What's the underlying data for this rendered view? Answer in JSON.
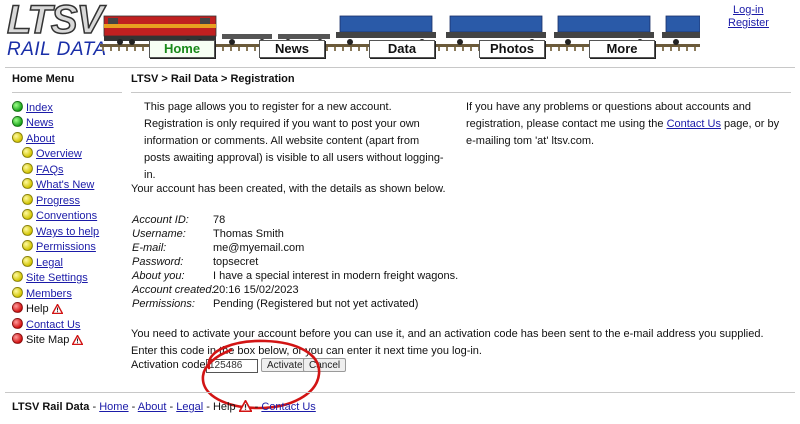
{
  "header": {
    "logo_top": "LTSV",
    "logo_bottom": "RAIL DATA",
    "nav": [
      "Home",
      "News",
      "Data",
      "Photos",
      "More"
    ],
    "active_nav": "Home",
    "auth": {
      "login": "Log-in",
      "register": "Register"
    }
  },
  "sidebar": {
    "heading": "Home Menu",
    "items": [
      {
        "label": "Index",
        "dot": "green"
      },
      {
        "label": "News",
        "dot": "green"
      },
      {
        "label": "About",
        "dot": "yellow"
      },
      {
        "label": "Overview",
        "dot": "yellow"
      },
      {
        "label": "FAQs",
        "dot": "yellow"
      },
      {
        "label": "What's New",
        "dot": "yellow"
      },
      {
        "label": "Progress",
        "dot": "yellow"
      },
      {
        "label": "Conventions",
        "dot": "yellow"
      },
      {
        "label": "Ways to help",
        "dot": "yellow"
      },
      {
        "label": "Permissions",
        "dot": "yellow"
      },
      {
        "label": "Legal",
        "dot": "yellow"
      },
      {
        "label": "Site Settings",
        "dot": "yellow"
      },
      {
        "label": "Members",
        "dot": "yellow"
      },
      {
        "label": "Help",
        "dot": "red"
      },
      {
        "label": "Contact Us",
        "dot": "red"
      },
      {
        "label": "Site Map",
        "dot": "red"
      }
    ]
  },
  "main": {
    "breadcrumb": "LTSV > Rail Data > Registration",
    "intro_left": "This page allows you to register for a new account. Registration is only required if you want to post your own information or comments. All website content (apart from posts awaiting approval) is visible to all users without logging-in.",
    "intro_right_before": "If you have any problems or questions about accounts and registration, please contact me using the ",
    "intro_right_link": "Contact Us",
    "intro_right_after": " page, or by e-mailing tom 'at' ltsv.com.",
    "created_msg": "Your account has been created, with the details as shown below.",
    "details": [
      {
        "label": "Account ID:",
        "value": "78"
      },
      {
        "label": "Username:",
        "value": "Thomas Smith"
      },
      {
        "label": "E-mail:",
        "value": "me@myemail.com"
      },
      {
        "label": "Password:",
        "value": "topsecret"
      },
      {
        "label": "About you:",
        "value": "I have a special interest in modern freight wagons."
      },
      {
        "label": "Account created:",
        "value": "20:16 15/02/2023"
      },
      {
        "label": "Permissions:",
        "value": "Pending (Registered but not yet activated)"
      }
    ],
    "activate_msg": "You need to activate your account before you can use it, and an activation code has been sent to the e-mail address you supplied. Enter this code in the box below, or you can enter it next time you log-in.",
    "activation_label": "Activation code:",
    "activation_value": "125486",
    "activate_button": "Activate",
    "cancel_button": "Cancel"
  },
  "footer": {
    "site": "LTSV Rail Data",
    "links": [
      "Home",
      "About",
      "Legal",
      "Help",
      "Contact Us"
    ]
  },
  "colors": {
    "link": "#1b1ba8",
    "logo_blue": "#1a2fa8",
    "annotation_red": "#d21414",
    "nav_active": "#1a8a1a"
  }
}
